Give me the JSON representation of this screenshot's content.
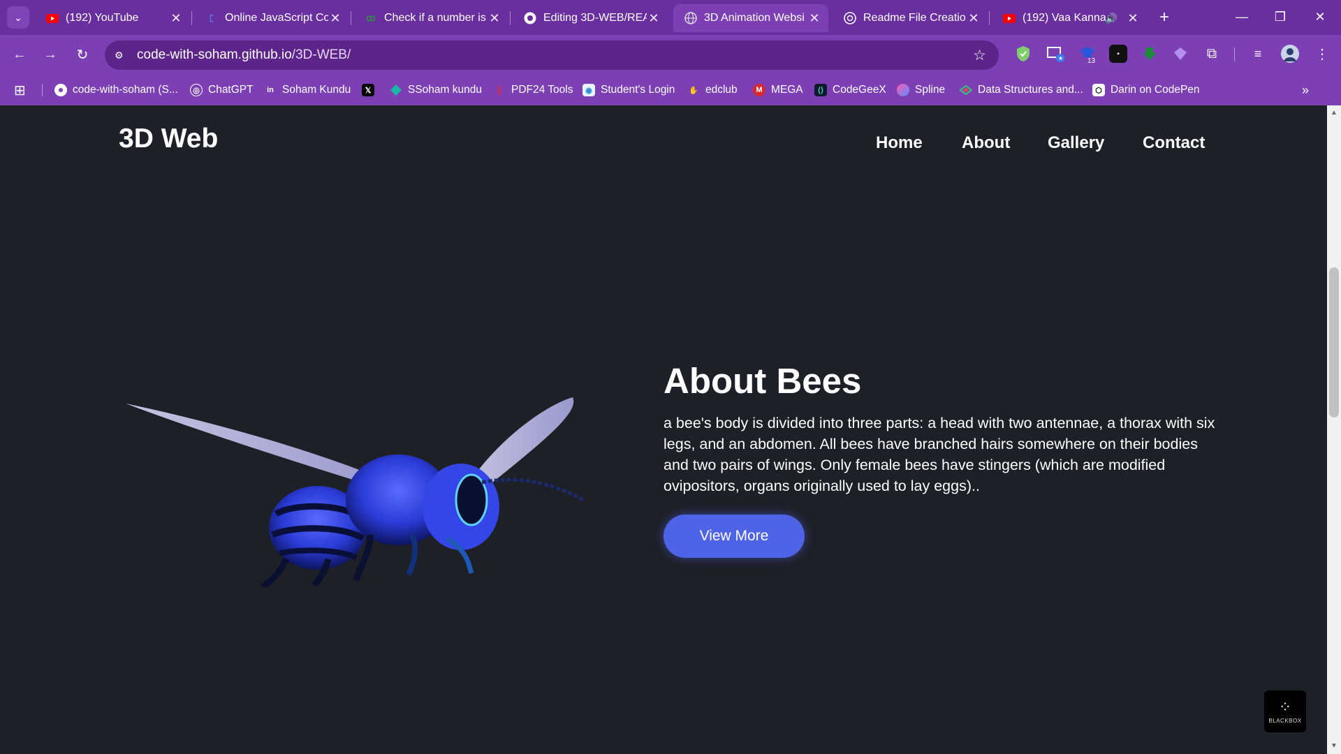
{
  "browser": {
    "tabs": [
      {
        "title": "(192) YouTube",
        "icon": "youtube-icon",
        "active": false
      },
      {
        "title": "Online JavaScript Co",
        "icon": "replit-icon",
        "active": false
      },
      {
        "title": "Check if a number is",
        "icon": "gfg-icon",
        "active": false
      },
      {
        "title": "Editing 3D-WEB/REA",
        "icon": "github-icon",
        "active": false
      },
      {
        "title": "3D Animation Websi",
        "icon": "globe-icon",
        "active": true
      },
      {
        "title": "Readme File Creatio",
        "icon": "chatgpt-icon",
        "active": false
      },
      {
        "title": "(192) Vaa Kannan",
        "icon": "youtube-icon",
        "active": false
      }
    ],
    "url_host": "code-with-soham.github.io",
    "url_path": "/3D-WEB/",
    "bookmarks": [
      {
        "label": "code-with-soham (S...",
        "icon": "github-icon"
      },
      {
        "label": "ChatGPT",
        "icon": "chatgpt-icon"
      },
      {
        "label": "Soham Kundu",
        "icon": "linkedin-icon"
      },
      {
        "label": "",
        "icon": "x-icon"
      },
      {
        "label": "SSoham kundu",
        "icon": "diamond-icon"
      },
      {
        "label": "PDF24 Tools",
        "icon": "pdf24-icon"
      },
      {
        "label": "Student's Login",
        "icon": "student-icon"
      },
      {
        "label": "edclub",
        "icon": "edclub-icon"
      },
      {
        "label": "MEGA",
        "icon": "mega-icon"
      },
      {
        "label": "CodeGeeX",
        "icon": "codegeex-icon"
      },
      {
        "label": "Spline",
        "icon": "spline-icon"
      },
      {
        "label": "Data Structures and...",
        "icon": "ds-icon"
      },
      {
        "label": "Darin on CodePen",
        "icon": "codepen-icon"
      }
    ],
    "extension_badge": "13"
  },
  "site": {
    "logo": "3D Web",
    "nav": [
      "Home",
      "About",
      "Gallery",
      "Contact"
    ],
    "heading": "About Bees",
    "paragraph": "a bee's body is divided into three parts: a head with two antennae, a thorax with six legs, and an abdomen. All bees have branched hairs somewhere on their bodies and two pairs of wings. Only female bees have stingers (which are modified ovipositors, organs originally used to lay eggs)..",
    "button": "View More",
    "badge_label": "BLACKBOX"
  },
  "colors": {
    "chrome": "#7d3fb4",
    "page_bg": "#1e2028",
    "button": "#4f63e6"
  }
}
